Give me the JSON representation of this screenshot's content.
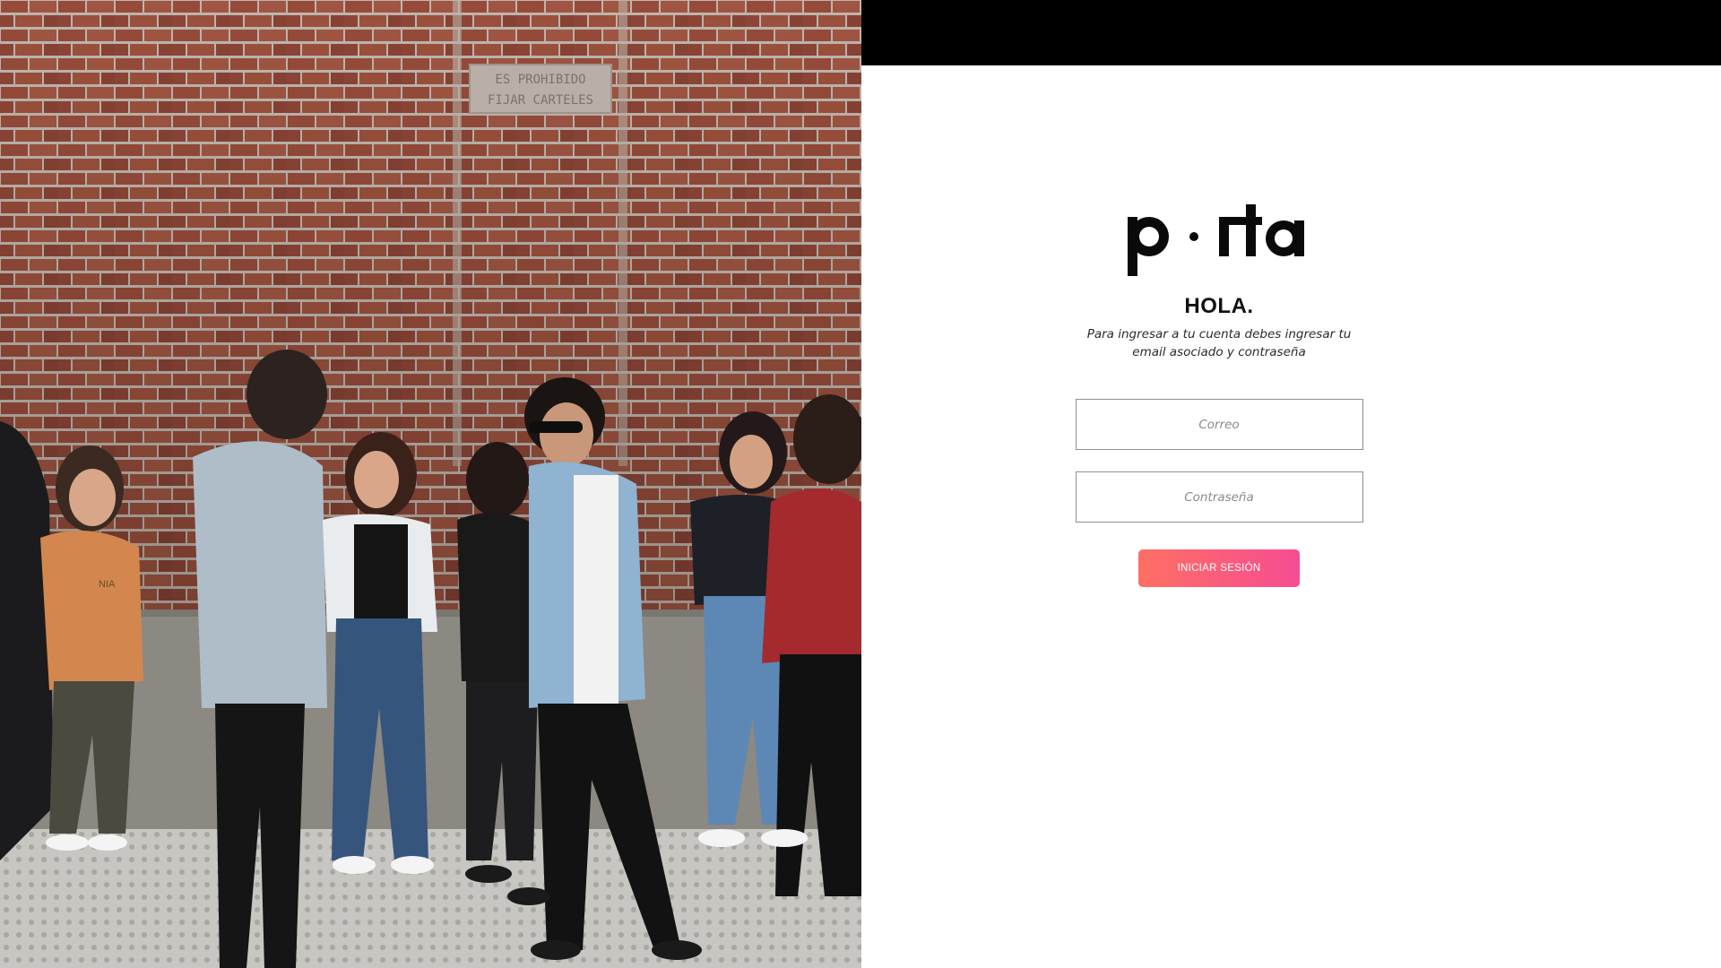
{
  "app": {
    "logo_text": "p · rta",
    "logo_icon": "porta-logo"
  },
  "photo": {
    "sign_line_1": "ES PROHIBIDO",
    "sign_line_2": "FIJAR CARTELES",
    "shirt_text": "NIA"
  },
  "login": {
    "greeting": "HOLA.",
    "instructions": "Para ingresar a tu cuenta debes ingresar tu email asociado y contraseña",
    "email_placeholder": "Correo",
    "email_value": "",
    "password_placeholder": "Contraseña",
    "password_value": "",
    "submit_label": "INICIAR SESIÓN"
  },
  "colors": {
    "top_bar": "#000000",
    "button_gradient_start": "#ff6f63",
    "button_gradient_end": "#f64c93",
    "brick": "#9b5443"
  }
}
